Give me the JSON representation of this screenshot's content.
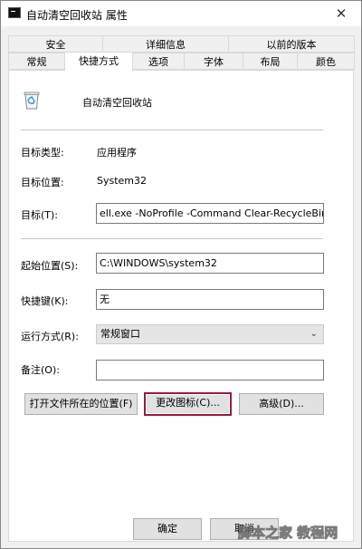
{
  "window": {
    "title": "自动清空回收站 属性",
    "close_glyph": "✕"
  },
  "tabs": {
    "row1": [
      "安全",
      "详细信息",
      "以前的版本"
    ],
    "row2": [
      "常规",
      "快捷方式",
      "选项",
      "字体",
      "布局",
      "颜色"
    ],
    "active": "快捷方式"
  },
  "shortcut": {
    "name": "自动清空回收站",
    "icon": "recycle-bin-icon",
    "target_type_label": "目标类型:",
    "target_type_value": "应用程序",
    "target_location_label": "目标位置:",
    "target_location_value": "System32",
    "target_label": "目标(T):",
    "target_value": "ell.exe -NoProfile -Command Clear-RecycleBin'",
    "start_in_label": "起始位置(S):",
    "start_in_value": "C:\\WINDOWS\\system32",
    "hotkey_label": "快捷键(K):",
    "hotkey_value": "无",
    "run_label": "运行方式(R):",
    "run_value": "常规窗口",
    "comment_label": "备注(O):",
    "comment_value": ""
  },
  "buttons": {
    "open_location": "打开文件所在的位置(F)",
    "change_icon": "更改图标(C)...",
    "advanced": "高级(D)..."
  },
  "footer": {
    "ok": "确定",
    "cancel": "取消"
  },
  "watermark": "脚本之家 教程网"
}
